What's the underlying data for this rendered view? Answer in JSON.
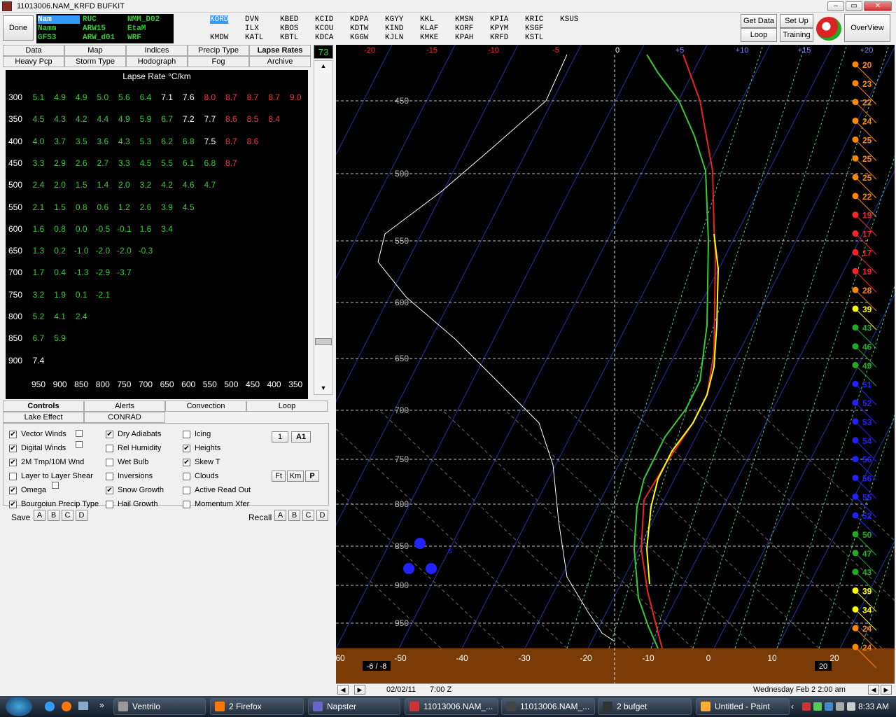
{
  "window": {
    "title": "11013006.NAM_KRFD BUFKIT"
  },
  "topbar": {
    "done": "Done",
    "get_data": "Get Data",
    "set_up": "Set Up",
    "loop": "Loop",
    "training": "Training",
    "overview": "OverView"
  },
  "models": [
    "Nam",
    "RUC",
    "NMM_D02",
    "Namm",
    "ARW15",
    "EtaM",
    "GFS3",
    "ARW_d01",
    "WRF"
  ],
  "stations": [
    "KORD",
    "DVN",
    "KBED",
    "KCID",
    "KDPA",
    "KGYY",
    "KKL",
    "KMSN",
    "KPIA",
    "KRIC",
    "KSUS",
    "ILX",
    "KBOS",
    "KCOU",
    "KDTW",
    "KIND",
    "KLAF",
    "KORF",
    "KPYM",
    "KSGF",
    "KMDW",
    "KATL",
    "KBTL",
    "KDCA",
    "KGGW",
    "KJLN",
    "KMKE",
    "KPAH",
    "KRFD",
    "KSTL"
  ],
  "tabs_row1": [
    "Data",
    "Map",
    "Indices",
    "Precip Type",
    "Lapse Rates"
  ],
  "tabs_row2": [
    "Heavy Pcp",
    "Storm Type",
    "Hodograph",
    "Fog",
    "Archive"
  ],
  "frame_counter": "73",
  "lapse": {
    "title": "Lapse Rate °C/km",
    "levels": [
      "300",
      "350",
      "400",
      "450",
      "500",
      "550",
      "600",
      "650",
      "700",
      "750",
      "800",
      "850",
      "900"
    ],
    "rows": [
      [
        "5.1",
        "4.9",
        "4.9",
        "5.0",
        "5.6",
        "6.4",
        "7.1",
        "7.6",
        "8.0",
        "8.7",
        "8.7",
        "8.7",
        "9.0"
      ],
      [
        "4.5",
        "4.3",
        "4.2",
        "4.4",
        "4.9",
        "5.9",
        "6.7",
        "7.2",
        "7.7",
        "8.6",
        "8.5",
        "8.4"
      ],
      [
        "4.0",
        "3.7",
        "3.5",
        "3.6",
        "4.3",
        "5.3",
        "6.2",
        "6.8",
        "7.5",
        "8.7",
        "8.6"
      ],
      [
        "3.3",
        "2.9",
        "2.6",
        "2.7",
        "3.3",
        "4.5",
        "5.5",
        "6.1",
        "6.8",
        "8.7"
      ],
      [
        "2.4",
        "2.0",
        "1.5",
        "1.4",
        "2.0",
        "3.2",
        "4.2",
        "4.6",
        "4.7"
      ],
      [
        "2.1",
        "1.5",
        "0.8",
        "0.6",
        "1.2",
        "2.6",
        "3.9",
        "4.5"
      ],
      [
        "1.6",
        "0.8",
        "0.0",
        "-0.5",
        "-0.1",
        "1.6",
        "3.4"
      ],
      [
        "1.3",
        "0.2",
        "-1.0",
        "-2.0",
        "-2.0",
        "-0.3"
      ],
      [
        "1.7",
        "0.4",
        "-1.3",
        "-2.9",
        "-3.7"
      ],
      [
        "3.2",
        "1.9",
        "0.1",
        "-2.1"
      ],
      [
        "5.2",
        "4.1",
        "2.4"
      ],
      [
        "6.7",
        "5.9"
      ],
      [
        "7.4"
      ]
    ],
    "bottom": [
      "950",
      "900",
      "850",
      "800",
      "750",
      "700",
      "650",
      "600",
      "550",
      "500",
      "450",
      "400",
      "350"
    ]
  },
  "ctrl_tabs1": [
    "Controls",
    "Alerts",
    "Convection",
    "Loop"
  ],
  "ctrl_tabs2": [
    "Lake Effect",
    "CONRAD"
  ],
  "options": [
    {
      "label": "Vector Winds",
      "checked": true
    },
    {
      "label": "Digital Winds",
      "checked": true
    },
    {
      "label": "2M Tmp/10M Wnd",
      "checked": true
    },
    {
      "label": "Layer to Layer Shear",
      "checked": false
    },
    {
      "label": "Omega",
      "checked": true
    },
    {
      "label": "Bourgoiun Precip Type",
      "checked": true
    },
    {
      "label": "Dry Adiabats",
      "checked": true
    },
    {
      "label": "Rel Humidity",
      "checked": false
    },
    {
      "label": "Wet Bulb",
      "checked": false
    },
    {
      "label": "Inversions",
      "checked": false
    },
    {
      "label": "Snow Growth",
      "checked": true
    },
    {
      "label": "Hail Growth",
      "checked": false
    },
    {
      "label": "Icing",
      "checked": false
    },
    {
      "label": "Heights",
      "checked": true
    },
    {
      "label": "Skew T",
      "checked": true
    },
    {
      "label": "Clouds",
      "checked": false
    },
    {
      "label": "Active Read Out",
      "checked": false
    },
    {
      "label": "Momentum Xfer",
      "checked": false
    }
  ],
  "small_btns": [
    "1",
    "A1",
    "Ft",
    "Km",
    "P"
  ],
  "save": {
    "label": "Save",
    "recall": "Recall",
    "slots": [
      "A",
      "B",
      "C",
      "D"
    ]
  },
  "skewt": {
    "top_axis": [
      "-20",
      "-15",
      "-10",
      "-5",
      "0",
      "+5",
      "+10",
      "+15",
      "+20"
    ],
    "pressures": [
      "450",
      "500",
      "550",
      "600",
      "650",
      "700",
      "750",
      "800",
      "850",
      "900",
      "950"
    ],
    "bottom_axis": [
      "-60",
      "-50",
      "-40",
      "-30",
      "-20",
      "-10",
      "0",
      "10",
      "20"
    ],
    "bottom_left": "-6 / -8",
    "bottom_right": "20",
    "rh_mark": "s",
    "winds": [
      {
        "v": "20",
        "c": "#f80"
      },
      {
        "v": "23",
        "c": "#f80"
      },
      {
        "v": "22",
        "c": "#f80"
      },
      {
        "v": "24",
        "c": "#f80"
      },
      {
        "v": "25",
        "c": "#f80"
      },
      {
        "v": "25",
        "c": "#f80"
      },
      {
        "v": "25",
        "c": "#f80"
      },
      {
        "v": "22",
        "c": "#f80"
      },
      {
        "v": "19",
        "c": "#f22"
      },
      {
        "v": "17",
        "c": "#f22"
      },
      {
        "v": "17",
        "c": "#f22"
      },
      {
        "v": "19",
        "c": "#f22"
      },
      {
        "v": "28",
        "c": "#f80"
      },
      {
        "v": "39",
        "c": "#ff0"
      },
      {
        "v": "43",
        "c": "#2a2"
      },
      {
        "v": "46",
        "c": "#2a2"
      },
      {
        "v": "49",
        "c": "#2a2"
      },
      {
        "v": "51",
        "c": "#22f"
      },
      {
        "v": "52",
        "c": "#22f"
      },
      {
        "v": "53",
        "c": "#22f"
      },
      {
        "v": "54",
        "c": "#22f"
      },
      {
        "v": "56",
        "c": "#22f"
      },
      {
        "v": "56",
        "c": "#22f"
      },
      {
        "v": "55",
        "c": "#22f"
      },
      {
        "v": "52",
        "c": "#22f"
      },
      {
        "v": "50",
        "c": "#2a2"
      },
      {
        "v": "47",
        "c": "#2a2"
      },
      {
        "v": "43",
        "c": "#2a2"
      },
      {
        "v": "39",
        "c": "#ff0"
      },
      {
        "v": "34",
        "c": "#ff0"
      },
      {
        "v": "24",
        "c": "#f80"
      },
      {
        "v": "24",
        "c": "#f80"
      }
    ]
  },
  "status": {
    "date": "02/02/11",
    "time": "7:00 Z",
    "local": "Wednesday   Feb 2  2:00 am"
  },
  "taskbar": {
    "items": [
      "Ventrilo",
      "2 Firefox",
      "Napster",
      "11013006.NAM_...",
      "11013006.NAM_...",
      "2 bufget",
      "Untitled - Paint"
    ],
    "clock": "8:33 AM"
  }
}
